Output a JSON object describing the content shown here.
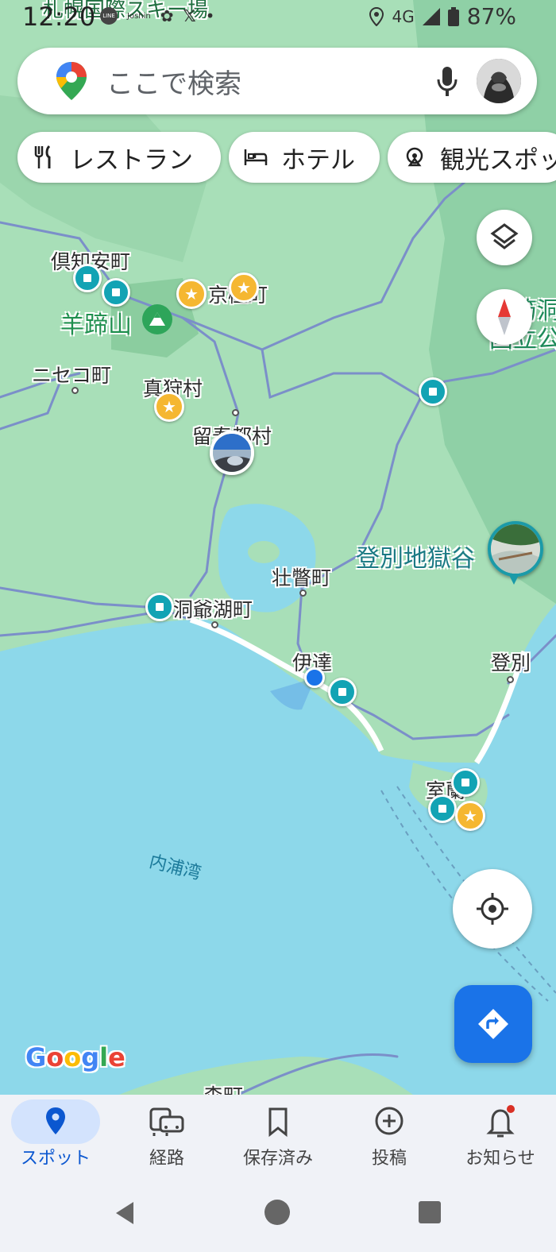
{
  "status_bar": {
    "time": "12:20",
    "left_icons": [
      "line-icon",
      "joshin-icon",
      "apps-icon",
      "x-icon",
      "dot-icon"
    ],
    "network": "4G",
    "battery": "87%"
  },
  "search": {
    "placeholder": "ここで検索"
  },
  "chips": [
    {
      "label": "レストラン",
      "icon": "restaurant-icon"
    },
    {
      "label": "ホテル",
      "icon": "hotel-icon"
    },
    {
      "label": "観光スポッ",
      "icon": "attraction-icon"
    }
  ],
  "map": {
    "top_partial_label": "札幌国際スキー場",
    "places": {
      "kutchan": "倶知安町",
      "kyogoku": "京極町",
      "niseko": "ニセコ町",
      "makkari": "真狩村",
      "rusutsu": "留寿都村",
      "sobetsu": "壮瞥町",
      "toyako": "洞爺湖町",
      "date": "伊達",
      "noboribetsu": "登別",
      "muroran": "室蘭",
      "bottom_partial": "森町"
    },
    "mountain": "羊蹄山",
    "park": [
      "支笏洞爺",
      "国立公園"
    ],
    "poi": "登別地獄谷",
    "bay": "内浦湾",
    "logo": "Google",
    "colors": {
      "land": "#a8dfb8",
      "water": "#8dd8ea",
      "forest": "#8fd0a6",
      "transit": "#12a3b4",
      "star": "#f5b731",
      "location": "#1a73e8"
    }
  },
  "bottom_nav": [
    {
      "label": "スポット",
      "icon": "place-icon",
      "active": true
    },
    {
      "label": "経路",
      "icon": "commute-icon",
      "active": false
    },
    {
      "label": "保存済み",
      "icon": "bookmark-icon",
      "active": false
    },
    {
      "label": "投稿",
      "icon": "add-circle-icon",
      "active": false
    },
    {
      "label": "お知らせ",
      "icon": "bell-icon",
      "active": false
    }
  ]
}
